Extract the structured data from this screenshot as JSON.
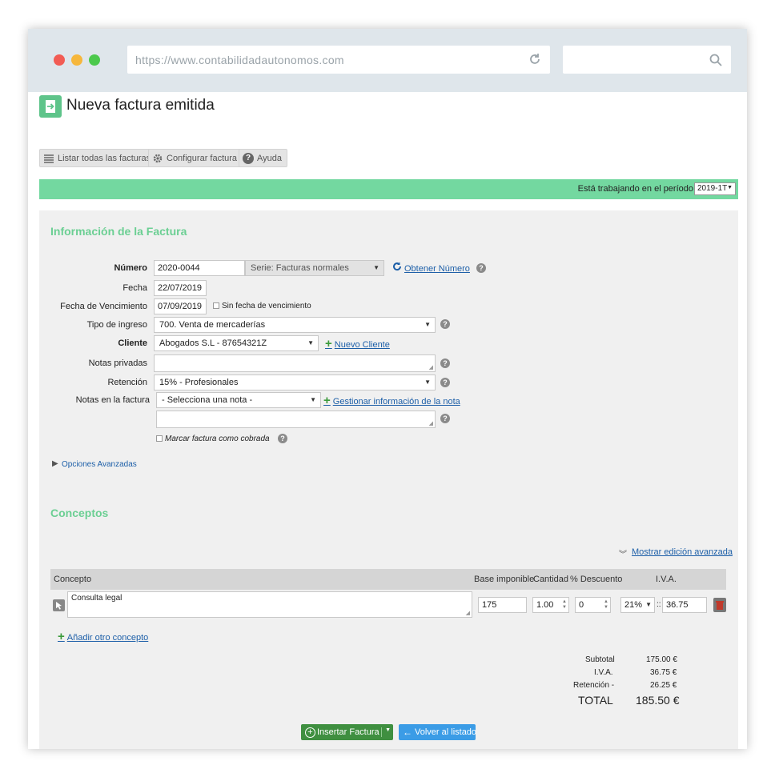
{
  "browser": {
    "url": "https://www.contabilidadautonomos.com",
    "search_placeholder": ""
  },
  "page": {
    "title": "Nueva factura emitida"
  },
  "toolbar": {
    "list_label": "Listar todas las facturas",
    "config_label": "Configurar factura",
    "help_label": "Ayuda"
  },
  "period": {
    "label": "Está trabajando en el período",
    "value": "2019-1T"
  },
  "info": {
    "section_title": "Información de la Factura",
    "numero_label": "Número",
    "numero_value": "2020-0044",
    "serie_value": "Serie: Facturas normales",
    "obtener_label": "Obtener Número",
    "fecha_label": "Fecha",
    "fecha_value": "22/07/2019",
    "vencimiento_label": "Fecha de Vencimiento",
    "vencimiento_value": "07/09/2019",
    "sin_fecha_label": "Sin fecha de vencimiento",
    "tipo_label": "Tipo de ingreso",
    "tipo_value": "700. Venta de mercaderías",
    "cliente_label": "Cliente",
    "cliente_value": "Abogados S.L - 87654321Z",
    "nuevo_cliente_label": "Nuevo Cliente",
    "notas_privadas_label": "Notas privadas",
    "notas_privadas_value": "",
    "retencion_label": "Retención",
    "retencion_value": "15% - Profesionales",
    "notas_factura_label": "Notas en la factura",
    "notas_factura_select": "- Selecciona una nota -",
    "gestionar_label": "Gestionar información de la nota",
    "notas_factura_text": "",
    "marcar_label": "Marcar factura como cobrada",
    "opciones_label": "Opciones Avanzadas"
  },
  "conceptos": {
    "section_title": "Conceptos",
    "mostrar_label": "Mostrar edición avanzada",
    "headers": {
      "concepto": "Concepto",
      "base": "Base imponible",
      "cantidad": "Cantidad",
      "descuento": "% Descuento",
      "iva": "I.V.A."
    },
    "row": {
      "concepto": "Consulta legal",
      "base": "175",
      "cantidad": "1.00",
      "descuento": "0",
      "iva_rate": "21%",
      "iva_sep": "::",
      "iva_amount": "36.75"
    },
    "add_label": "Añadir otro concepto"
  },
  "totals": {
    "subtotal_label": "Subtotal",
    "subtotal_value": "175.00 €",
    "iva_label": "I.V.A.",
    "iva_value": "36.75 €",
    "retencion_label": "Retención -",
    "retencion_value": "26.25 €",
    "total_label": "TOTAL",
    "total_value": "185.50 €"
  },
  "actions": {
    "insert_label": "Insertar Factura",
    "back_label": "Volver al listado"
  },
  "colors": {
    "accent_green": "#73d8a0",
    "section_title": "#6bcf93",
    "link_blue": "#1d5fa8",
    "insert_button": "#3f8f40",
    "back_button": "#3b9ce6"
  }
}
